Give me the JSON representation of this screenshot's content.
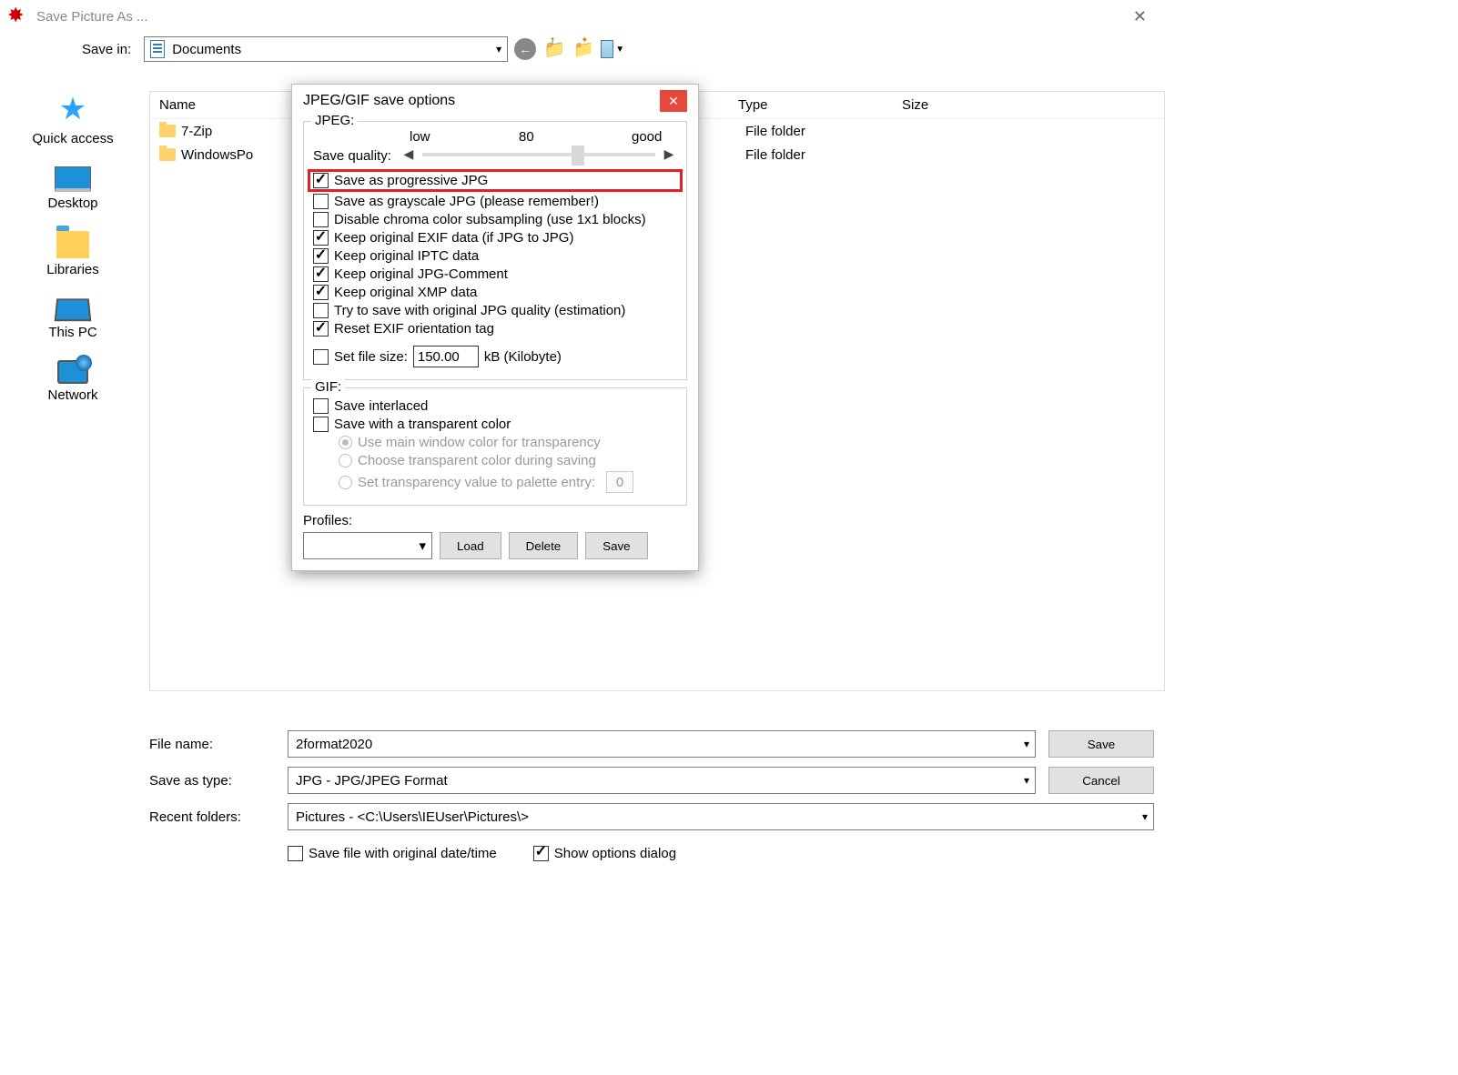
{
  "window": {
    "title": "Save Picture As ...",
    "close": "✕"
  },
  "savein": {
    "label": "Save in:",
    "value": "Documents"
  },
  "columns": {
    "name": "Name",
    "type": "Type",
    "size": "Size"
  },
  "files": [
    {
      "name": "7-Zip",
      "type": "File folder"
    },
    {
      "name": "WindowsPo",
      "type": "File folder"
    }
  ],
  "places": {
    "quick": "Quick access",
    "desktop": "Desktop",
    "libraries": "Libraries",
    "thispc": "This PC",
    "network": "Network"
  },
  "bottom": {
    "filename_label": "File name:",
    "filename_value": "2format2020",
    "type_label": "Save as type:",
    "type_value": "JPG - JPG/JPEG Format",
    "recent_label": "Recent folders:",
    "recent_value": "Pictures  -  <C:\\Users\\IEUser\\Pictures\\>",
    "save": "Save",
    "cancel": "Cancel",
    "save_date": "Save file with original date/time",
    "show_options": "Show options dialog"
  },
  "modal": {
    "title": "JPEG/GIF save options",
    "jpeg_legend": "JPEG:",
    "quality_label": "Save quality:",
    "quality_low": "low",
    "quality_value": "80",
    "quality_good": "good",
    "progressive": "Save as progressive JPG",
    "grayscale": "Save as grayscale JPG (please remember!)",
    "chroma": "Disable chroma color subsampling (use 1x1 blocks)",
    "exif": "Keep original EXIF data (if JPG to JPG)",
    "iptc": "Keep original IPTC data",
    "comment": "Keep original JPG-Comment",
    "xmp": "Keep original XMP data",
    "estquality": "Try to save with original JPG quality (estimation)",
    "resetorient": "Reset EXIF orientation tag",
    "filesize_label": "Set file size:",
    "filesize_value": "150.00",
    "filesize_unit": "kB (Kilobyte)",
    "gif_legend": "GIF:",
    "interlaced": "Save interlaced",
    "save_trans": "Save with a transparent color",
    "trans_main": "Use main window color for transparency",
    "trans_choose": "Choose transparent color during saving",
    "trans_palette": "Set transparency value to palette entry:",
    "palette_value": "0",
    "profiles_label": "Profiles:",
    "load": "Load",
    "delete": "Delete",
    "psave": "Save"
  }
}
